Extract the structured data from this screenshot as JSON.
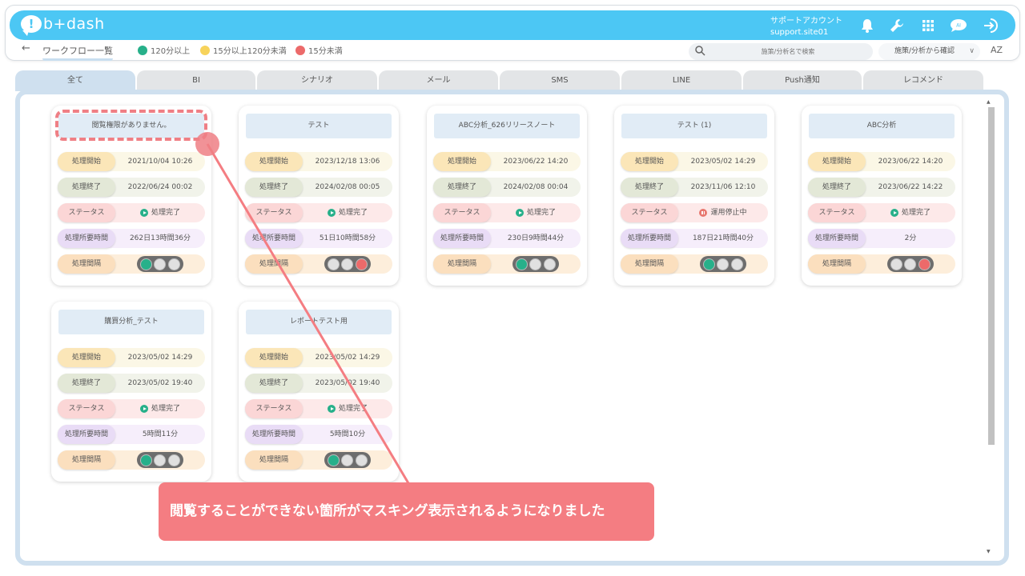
{
  "header": {
    "logo_text": "b+dash",
    "account_name": "サポートアカウント",
    "account_site": "support.site01",
    "icons": [
      "bell-icon",
      "wrench-icon",
      "grid-icon",
      "chat-icon",
      "logout-icon"
    ]
  },
  "subbar": {
    "back_icon": "←",
    "breadcrumb": "ワークフロー一覧",
    "legend": [
      {
        "label": "120分以上",
        "color": "#27b08a"
      },
      {
        "label": "15分以上120分未満",
        "color": "#f7d35b"
      },
      {
        "label": "15分未満",
        "color": "#ec6a6a"
      }
    ],
    "search_placeholder": "施策/分析名で検索",
    "select_value": "施策/分析から確認",
    "sort_label": "AZ"
  },
  "tabs": [
    "全て",
    "BI",
    "シナリオ",
    "メール",
    "SMS",
    "LINE",
    "Push通知",
    "レコメンド"
  ],
  "row_labels": {
    "start": "処理開始",
    "end": "処理終了",
    "status": "ステータス",
    "duration": "処理所要時間",
    "interval": "処理間隔"
  },
  "cards": [
    {
      "title": "閲覧権限がありません。",
      "start": "2021/10/04 10:26",
      "end": "2022/06/24 00:02",
      "status": "処理完了",
      "status_type": "done",
      "duration": "262日13時間36分",
      "lights": [
        "green",
        "off",
        "off"
      ]
    },
    {
      "title": "テスト",
      "start": "2023/12/18 13:06",
      "end": "2024/02/08 00:05",
      "status": "処理完了",
      "status_type": "done",
      "duration": "51日10時間58分",
      "lights": [
        "off",
        "off",
        "red"
      ]
    },
    {
      "title": "ABC分析_626リリースノート",
      "start": "2023/06/22 14:20",
      "end": "2024/02/08 00:04",
      "status": "処理完了",
      "status_type": "done",
      "duration": "230日9時間44分",
      "lights": [
        "green",
        "off",
        "off"
      ]
    },
    {
      "title": "テスト (1)",
      "start": "2023/05/02 14:29",
      "end": "2023/11/06 12:10",
      "status": "運用停止中",
      "status_type": "stopped",
      "duration": "187日21時間40分",
      "lights": [
        "green",
        "off",
        "off"
      ]
    },
    {
      "title": "ABC分析",
      "start": "2023/06/22 14:20",
      "end": "2023/06/22 14:22",
      "status": "処理完了",
      "status_type": "done",
      "duration": "2分",
      "lights": [
        "off",
        "off",
        "red"
      ]
    },
    {
      "title": "購買分析_テスト",
      "start": "2023/05/02 14:29",
      "end": "2023/05/02 19:40",
      "status": "処理完了",
      "status_type": "done",
      "duration": "5時間11分",
      "lights": [
        "green",
        "off",
        "off"
      ]
    },
    {
      "title": "レポートテスト用",
      "start": "2023/05/02 14:29",
      "end": "2023/05/02 19:40",
      "status": "処理完了",
      "status_type": "done",
      "duration": "5時間10分",
      "lights": [
        "green",
        "off",
        "off"
      ]
    }
  ],
  "callout": {
    "text": "閲覧することができない箇所がマスキング表示されるようになりました",
    "color": "#f47d82"
  }
}
